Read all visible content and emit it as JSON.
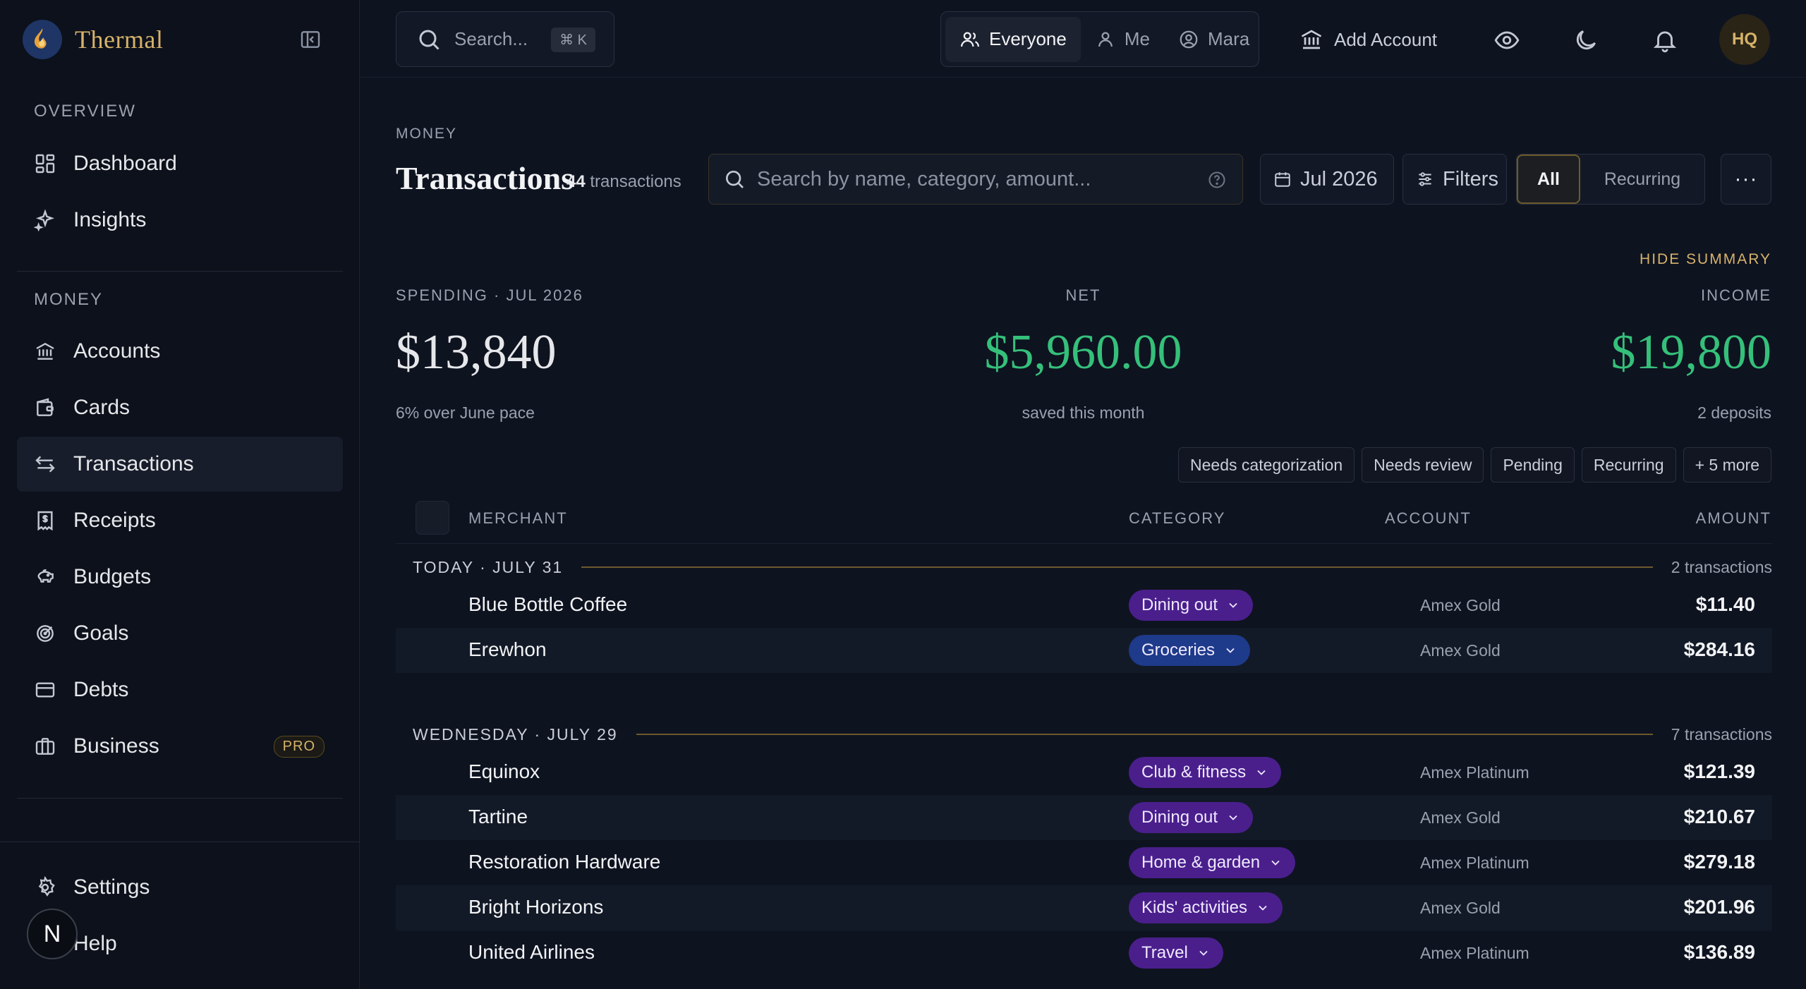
{
  "brand": {
    "name": "Thermal"
  },
  "sidebar": {
    "overview_label": "OVERVIEW",
    "overview_items": [
      {
        "label": "Dashboard",
        "icon": "dashboard-icon"
      },
      {
        "label": "Insights",
        "icon": "sparkle-icon"
      }
    ],
    "money_label": "MONEY",
    "money_items": [
      {
        "label": "Accounts",
        "icon": "bank-icon"
      },
      {
        "label": "Cards",
        "icon": "wallet-icon"
      },
      {
        "label": "Transactions",
        "icon": "arrows-swap-icon",
        "active": true
      },
      {
        "label": "Receipts",
        "icon": "receipt-icon"
      },
      {
        "label": "Budgets",
        "icon": "piggy-bank-icon"
      },
      {
        "label": "Goals",
        "icon": "target-icon"
      },
      {
        "label": "Debts",
        "icon": "credit-card-icon"
      },
      {
        "label": "Business",
        "icon": "briefcase-icon",
        "badge": "PRO"
      }
    ],
    "footer_items": [
      {
        "label": "Settings",
        "icon": "gear-icon"
      },
      {
        "label": "Help",
        "icon": "help-icon"
      }
    ],
    "user_initial": "N"
  },
  "topbar": {
    "search_placeholder": "Search...",
    "search_shortcut": "⌘ K",
    "scope": [
      "Everyone",
      "Me",
      "Mara"
    ],
    "scope_selected": "Everyone",
    "add_account": "Add Account",
    "avatar": "HQ"
  },
  "page": {
    "eyebrow": "MONEY",
    "title": "Transactions",
    "count_number": "44",
    "count_label": "transactions",
    "search_placeholder": "Search by name, category, amount...",
    "month": "Jul 2026",
    "filters": "Filters",
    "view_all": "All",
    "view_recurring": "Recurring",
    "more": "···"
  },
  "summary": {
    "hide_label": "HIDE SUMMARY",
    "spending": {
      "label": "SPENDING · JUL 2026",
      "value": "$13,840",
      "sub": "6% over June pace"
    },
    "net": {
      "label": "NET",
      "value": "$5,960.00",
      "sub": "saved this month"
    },
    "income": {
      "label": "INCOME",
      "value": "$19,800",
      "sub": "2 deposits"
    }
  },
  "quick_filters": [
    "Needs categorization",
    "Needs review",
    "Pending",
    "Recurring",
    "+ 5 more"
  ],
  "table": {
    "columns": {
      "merchant": "MERCHANT",
      "category": "CATEGORY",
      "account": "ACCOUNT",
      "amount": "AMOUNT"
    },
    "groups": [
      {
        "title": "TODAY · JULY 31",
        "count": "2 transactions",
        "rows": [
          {
            "merchant": "Blue Bottle Coffee",
            "category": "Dining out",
            "cat_color": "#4a1f8c",
            "account": "Amex Gold",
            "amount": "$11.40"
          },
          {
            "merchant": "Erewhon",
            "category": "Groceries",
            "cat_color": "#1e3a8a",
            "account": "Amex Gold",
            "amount": "$284.16"
          }
        ]
      },
      {
        "title": "WEDNESDAY · JULY 29",
        "count": "7 transactions",
        "rows": [
          {
            "merchant": "Equinox",
            "category": "Club & fitness",
            "cat_color": "#4a1f8c",
            "account": "Amex Platinum",
            "amount": "$121.39"
          },
          {
            "merchant": "Tartine",
            "category": "Dining out",
            "cat_color": "#4a1f8c",
            "account": "Amex Gold",
            "amount": "$210.67"
          },
          {
            "merchant": "Restoration Hardware",
            "category": "Home & garden",
            "cat_color": "#4a1f8c",
            "account": "Amex Platinum",
            "amount": "$279.18"
          },
          {
            "merchant": "Bright Horizons",
            "category": "Kids' activities",
            "cat_color": "#4a1f8c",
            "account": "Amex Gold",
            "amount": "$201.96"
          },
          {
            "merchant": "United Airlines",
            "category": "Travel",
            "cat_color": "#4a1f8c",
            "account": "Amex Platinum",
            "amount": "$136.89"
          }
        ]
      }
    ]
  },
  "colors": {
    "accent_gold": "#d6b26a",
    "positive_green": "#35c07a",
    "background": "#0e1320"
  }
}
